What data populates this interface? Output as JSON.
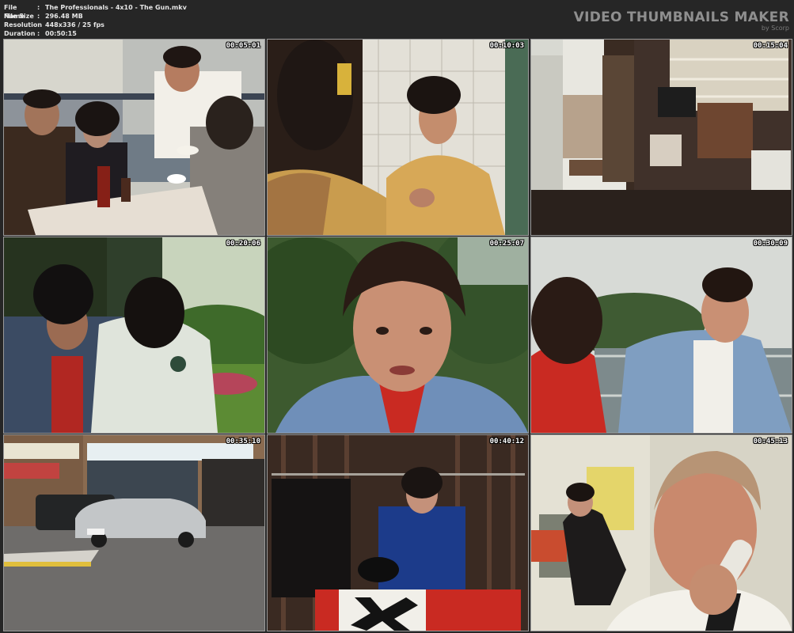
{
  "file_info": {
    "name_label": "File Name",
    "name_value": "The Professionals - 4x10 - The Gun.mkv",
    "size_label": "File Size",
    "size_value": "296.48 MB",
    "resolution_label": "Resolution",
    "resolution_value": "448x336 / 25 fps",
    "duration_label": "Duration",
    "duration_value": "00:50:15",
    "separator": ":"
  },
  "brand": {
    "title": "VIDEO THUMBNAILS MAKER",
    "subtitle": "by Scorp"
  },
  "thumbnails": [
    {
      "timestamp": "00:05:01"
    },
    {
      "timestamp": "00:10:03"
    },
    {
      "timestamp": "00:15:04"
    },
    {
      "timestamp": "00:20:06"
    },
    {
      "timestamp": "00:25:07"
    },
    {
      "timestamp": "00:30:09"
    },
    {
      "timestamp": "00:35:10"
    },
    {
      "timestamp": "00:40:12"
    },
    {
      "timestamp": "00:45:13"
    }
  ]
}
